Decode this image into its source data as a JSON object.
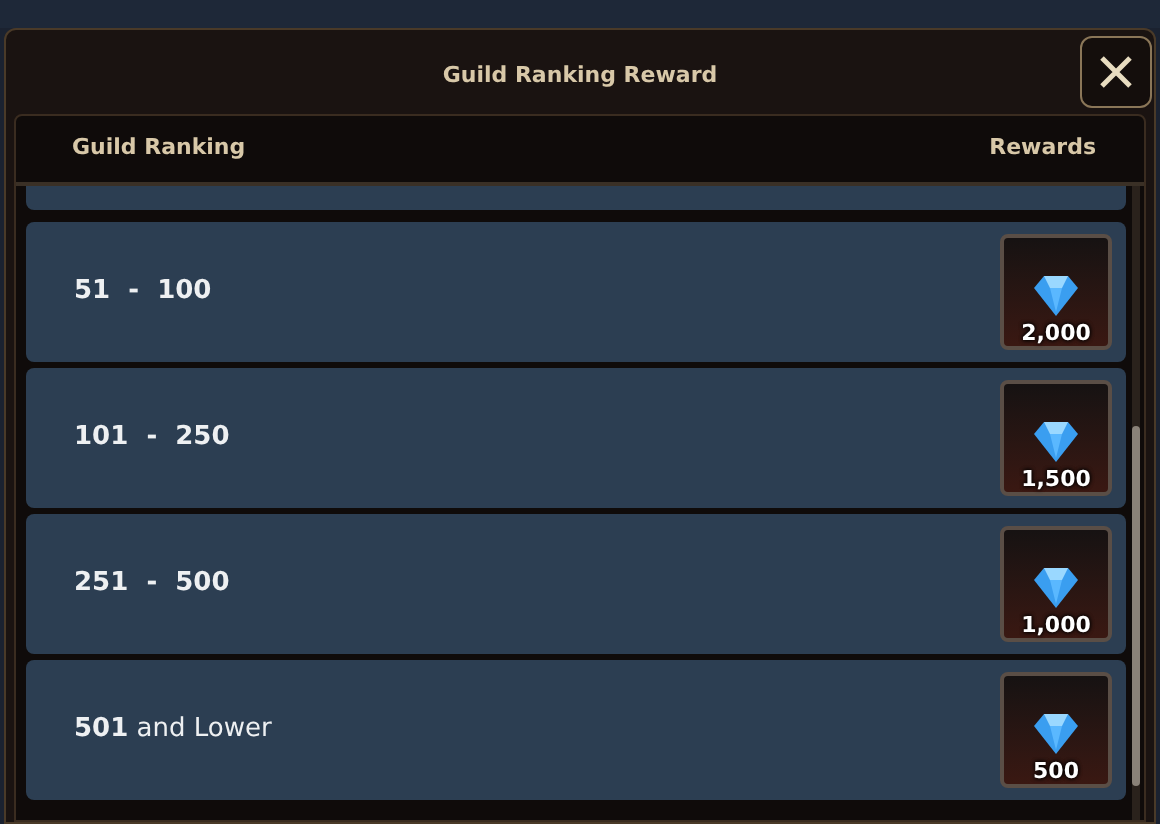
{
  "window": {
    "title": "Guild Ranking Reward"
  },
  "table": {
    "columns": [
      "Guild Ranking",
      "Rewards"
    ],
    "rows": [
      {
        "kind": "range",
        "rank": "51 - 100",
        "reward": "2,000"
      },
      {
        "kind": "range",
        "rank": "101 - 250",
        "reward": "1,500"
      },
      {
        "kind": "range",
        "rank": "251 - 500",
        "reward": "1,000"
      },
      {
        "kind": "open",
        "rank": "**501** and Lower",
        "reward": "500"
      }
    ]
  }
}
